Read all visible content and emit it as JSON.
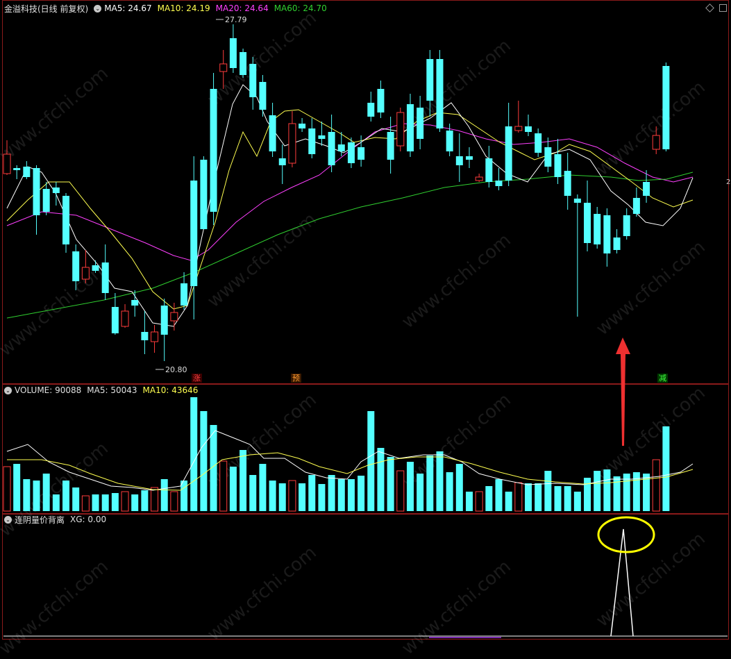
{
  "main": {
    "title": "金溢科技(日线 前复权)",
    "ma5": "MA5: 24.67",
    "ma10": "MA10: 24.19",
    "ma20": "MA20: 24.64",
    "ma60": "MA60: 24.70",
    "high_label": "27.79",
    "low_label": "20.80",
    "marks": [
      "涨",
      "预",
      "减"
    ],
    "edge_label": "2"
  },
  "volume": {
    "title": "VOLUME: 90088",
    "ma5": "MA5: 50043",
    "ma10": "MA10: 43646"
  },
  "indicator": {
    "title": "连阴量价背离",
    "xg": "XG: 0.00"
  },
  "watermark": "www.cfchi.com",
  "colors": {
    "up": "#ff3c3c",
    "down": "#54ffff",
    "ma5": "#ffffff",
    "ma10": "#ffff50",
    "ma20": "#ff40ff",
    "ma60": "#30d030",
    "annotation_arrow": "#ee3030",
    "annotation_circle": "#ffff00"
  },
  "icons": [
    "collapse-circle-icon",
    "diamond-icon",
    "square-icon",
    "red-up-arrow-icon",
    "yellow-ellipse-icon"
  ]
}
